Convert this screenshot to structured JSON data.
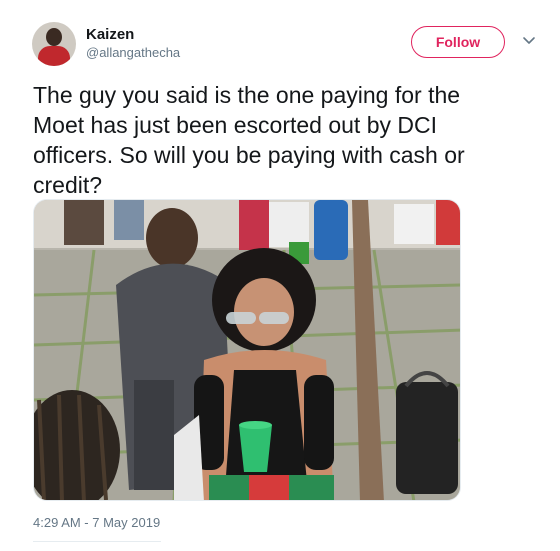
{
  "user": {
    "name": "Kaizen",
    "handle": "@allangathecha"
  },
  "follow_label": "Follow",
  "tweet": {
    "text": "The guy you said is the one paying for the\nMoet has just been escorted out by DCI\nofficers. So will you be paying with cash or\ncredit?"
  },
  "timestamp": "4:29 AM - 7 May 2019",
  "colors": {
    "accent": "#e0245e",
    "text": "#14171a",
    "secondary": "#657786",
    "border": "#e6ecf0"
  },
  "icons": {
    "menu": "chevron-down-icon"
  }
}
